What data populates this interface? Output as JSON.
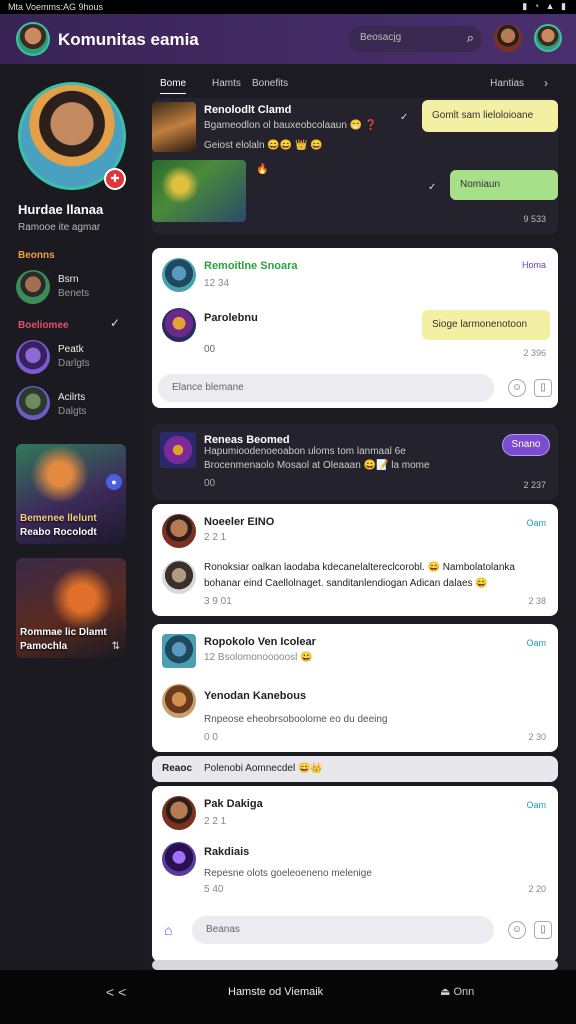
{
  "status_bar": {
    "left_text": "Mta Voemms:AG 9hous"
  },
  "app_bar": {
    "title": "Komunitas eamia",
    "search_placeholder": "Beosacjg"
  },
  "sidebar": {
    "profile_name": "Hurdae llanaa",
    "profile_sub": "Ramooe ite agmar",
    "section_1": "Beonns",
    "friend_1_name": "Bsrn",
    "friend_1_sub": "Benets",
    "section_2": "Boeliomee",
    "friend_2_name": "Peatk",
    "friend_2_sub": "Darlgts",
    "friend_3_name": "Acilrts",
    "friend_3_sub": "Dalgts",
    "promo_1_line1": "Bemenee llelunt",
    "promo_1_line2": "Reabo Rocolodt",
    "promo_2_line1": "Rommae lic Dlamt",
    "promo_2_line2": "Pamochla"
  },
  "tabs": {
    "tab_1": "Bome",
    "tab_2": "Hamts",
    "tab_3": "Bonefits",
    "filter": "Hantias"
  },
  "card_1": {
    "title": "Renolodlt Clamd",
    "line_1": "Bgameodlon ol bauxeobcolaaun 😁 ❓",
    "line_2": "Geiost elolaln 😄😄 👑 😄",
    "bubble": "Gomlt sam lieloloioane",
    "bubble_2": "Nomiaun",
    "time": "9 533"
  },
  "card_2": {
    "title": "Remoitlne Snoara",
    "chip": "Homa",
    "sub": "12 34",
    "name": "Parolebnu",
    "bubble": "Sioge larmonenotoon",
    "time": "2 396",
    "footer": "00",
    "input_placeholder": "Elance blemane"
  },
  "card_3": {
    "title": "Reneas Beomed",
    "line_1": "Hapumioodenoeoabon uloms tom lanmaal  6e",
    "line_2": "Brocenmenaolo Mosaol at Oleaaan 😀📝 la mome",
    "count": "00",
    "button": "Snano",
    "time": "2 237"
  },
  "card_4": {
    "title": "Noeeler EINO",
    "status": "Oam",
    "sub": "2 2 1",
    "body_1": "Ronoksiar oalkan laodaba kdecanelaltereclcorobl. 😄 Nambolatolanka",
    "body_2": "bohanar eind Caellolnaget. sanditanlendiogan Adican dalaes 😄",
    "time_left": "3 9 01",
    "time": "2 38"
  },
  "card_5": {
    "title": "Ropokolo Ven Icolear",
    "status": "Oam",
    "sub": "12 Bsolomonooooosl 😀",
    "name": "Yenodan Kanebous",
    "body": "Rnpeose eheobrsoboolome eo du deeing",
    "footer": "0 0",
    "time": "2 30"
  },
  "banner": {
    "label": "Reaoc",
    "text": "Polenobi Aomnecdel 😄👑"
  },
  "card_6": {
    "title": "Pak Dakiga",
    "status": "Oam",
    "sub": "2 2 1",
    "name": "Rakdiais",
    "body": "Repesne olots goeleoeneno melenige",
    "time_left": "5 40",
    "time": "2 20",
    "input_placeholder": "Beanas"
  },
  "bottom_nav": {
    "back": "< <",
    "center": "Hamste od Viemaik",
    "right": "Onn"
  }
}
